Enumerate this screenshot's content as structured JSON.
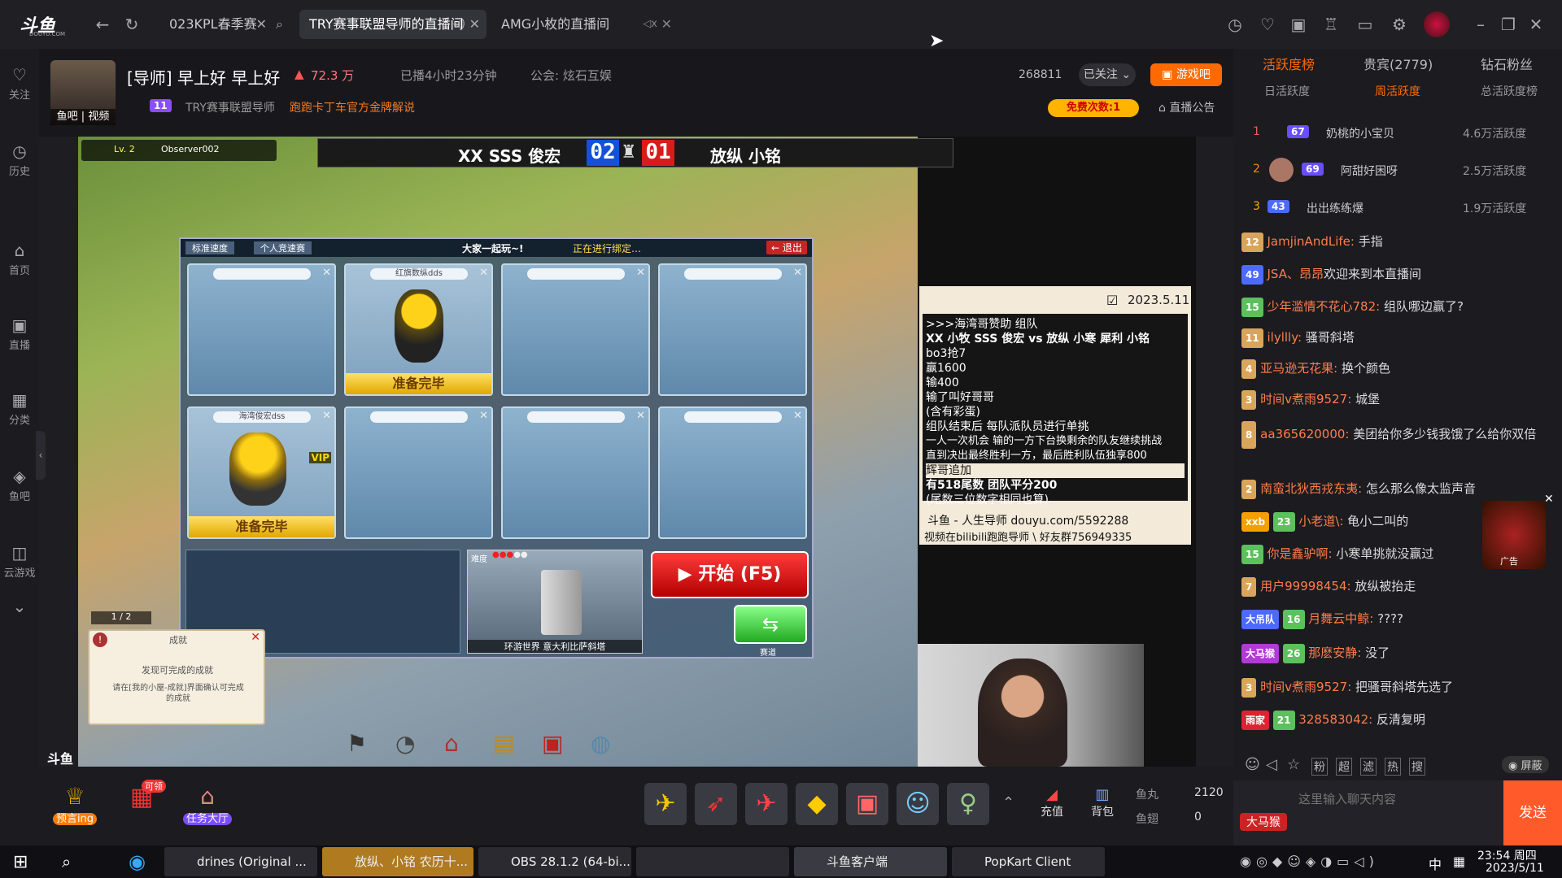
{
  "browser": {
    "logo": "斗鱼",
    "logo_sub": "DOUYU.COM",
    "tabs": [
      {
        "label": "023KPL春季赛"
      },
      {
        "label": "TRY赛事联盟导师的直播间"
      },
      {
        "label": "AMG小枚的直播间"
      }
    ]
  },
  "rail": {
    "items": [
      {
        "label": "关注",
        "icon": "heart-icon"
      },
      {
        "label": "历史",
        "icon": "clock-icon"
      },
      {
        "label": "首页",
        "icon": "home-icon"
      },
      {
        "label": "直播",
        "icon": "tv-icon"
      },
      {
        "label": "分类",
        "icon": "grid-icon"
      },
      {
        "label": "鱼吧",
        "icon": "fish-icon"
      },
      {
        "label": "云游戏",
        "icon": "gamepad-icon"
      }
    ]
  },
  "streamer": {
    "avatar_caption": "鱼吧 | 视频",
    "title": "[导师] 早上好 早上好",
    "heat": "72.3 万",
    "live_time": "已播4小时23分钟",
    "guild": "公会: 炫石互娱",
    "badge_level": "11",
    "tag": "TRY赛事联盟导师",
    "promo": "跑跑卡丁车官方金牌解说",
    "room_id": "268811",
    "follow_label": "已关注",
    "play_label": "游戏吧",
    "free_label": "免费次数:1",
    "notice_label": "直播公告"
  },
  "game": {
    "observer_level": "Lv. 2",
    "observer_name": "Observer002",
    "team_left": "XX SSS 俊宏",
    "score_left": "02",
    "score_right": "01",
    "team_right": "放纵 小铭",
    "mode_tab1": "标准速度",
    "mode_tab2": "个人竞速赛",
    "room_title": "大家一起玩~!",
    "room_status": "正在进行绑定…",
    "exit_label": "退出",
    "slot_names": [
      "红旗数纵dds",
      "海湾俊宏dss"
    ],
    "ready_label": "准备完毕",
    "vip_label": "VIP",
    "page_indicator": "1 / 2",
    "map_name": "环游世界 意大利比萨斜塔",
    "map_difficulty": "难度",
    "start_label": "开始 (F5)",
    "track_label": "赛道",
    "ach_title": "成就",
    "ach_line1": "发现可完成的成就",
    "ach_line2": "请在[我的小屋-成就]界面确认可完成的成就",
    "douyu_watermark": "斗鱼"
  },
  "notice_board": {
    "date": "2023.5.11",
    "lines": [
      ">>>海湾哥赞助  组队",
      "XX 小牧 SSS 俊宏 vs 放纵 小寒 犀利 小铭",
      "bo3抢7",
      "赢1600",
      "输400",
      "输了叫好哥哥",
      "(含有彩蛋)",
      "组队结束后 每队派队员进行单挑",
      "一人一次机会 输的一方下台换剩余的队友继续挑战",
      "直到决出最终胜利一方，最后胜利队伍独享800"
    ],
    "highlight": "辉哥追加",
    "extra_lines": [
      "有518尾数 团队平分200",
      "(尾数三位数字相同也算)"
    ],
    "footer1": "斗鱼 - 人生导师 douyu.com/5592288",
    "footer2": "视频在bilibili跑跑导师 \\ 好友群756949335"
  },
  "giftbar": {
    "left_items": [
      {
        "label": "预言ing"
      },
      {
        "label": "可领"
      },
      {
        "label": "任务大厅"
      }
    ],
    "recharge_label": "充值",
    "bag_label": "背包",
    "fishball_label": "鱼丸",
    "fishball_value": "2120",
    "fishfin_label": "鱼翅",
    "fishfin_value": "0"
  },
  "right_panel": {
    "tabs": [
      "活跃度榜",
      "贵宾(2779)",
      "钻石粉丝"
    ],
    "subtabs": [
      "日活跃度",
      "周活跃度",
      "总活跃度榜"
    ],
    "ranks": [
      {
        "rank": "1",
        "level": "67",
        "name": "奶桃的小宝贝",
        "score": "4.6万活跃度"
      },
      {
        "rank": "2",
        "level": "69",
        "name": "阿甜好困呀",
        "score": "2.5万活跃度"
      },
      {
        "rank": "3",
        "level": "43",
        "name": "出出练练爆",
        "score": "1.9万活跃度"
      }
    ],
    "chat": [
      {
        "level": "12",
        "user": "JamjinAndLife:",
        "text": "手指"
      },
      {
        "level": "49",
        "user": "JSA、昂昂",
        "text": "欢迎来到本直播间"
      },
      {
        "level": "15",
        "user": "少年滥情不花心782:",
        "text": "组队哪边赢了?"
      },
      {
        "level": "11",
        "user": "ilyllly:",
        "text": "骚哥斜塔"
      },
      {
        "level": "4",
        "user": "亚马逊无花果:",
        "text": "换个颜色"
      },
      {
        "level": "3",
        "user": "时间v煮雨9527:",
        "text": "城堡"
      },
      {
        "level": "8",
        "user": "aa365620000:",
        "text": "美团给你多少钱我饿了么给你双倍"
      },
      {
        "level": "2",
        "user": "南蛮北狄西戎东夷:",
        "text": "怎么那么像太监声音"
      },
      {
        "level": "23",
        "user": "小老道\\:",
        "text": "龟小二叫的",
        "fan": "xxb"
      },
      {
        "level": "15",
        "user": "你是鑫驴啊:",
        "text": "小寒单挑就没赢过"
      },
      {
        "level": "7",
        "user": "用户99998454:",
        "text": "放纵被抬走"
      },
      {
        "level": "16",
        "user": "月舞云中鲸:",
        "text": "????",
        "fan": "大吊队"
      },
      {
        "level": "26",
        "user": "那麽安静:",
        "text": "没了",
        "fan": "大马猴"
      },
      {
        "level": "3",
        "user": "时间v煮雨9527:",
        "text": "把骚哥斜塔先选了"
      },
      {
        "level": "21",
        "user": "328583042:",
        "text": "反清复明",
        "fan": "雨家"
      }
    ],
    "ad_label": "广告",
    "block_label": "屏蔽",
    "tools": [
      "粉",
      "超",
      "滤",
      "热",
      "搜"
    ],
    "input_placeholder": "这里输入聊天内容",
    "fan_badge": "大马猴",
    "send_label": "发送"
  },
  "taskbar": {
    "apps": [
      {
        "label": "drines (Original ..."
      },
      {
        "label": "放纵、小铭 农历十..."
      },
      {
        "label": "OBS 28.1.2 (64-bi..."
      },
      {
        "label": ""
      },
      {
        "label": "斗鱼客户端"
      },
      {
        "label": "PopKart Client"
      }
    ],
    "ime": "中",
    "time": "23:54 周四",
    "date": "2023/5/11"
  }
}
